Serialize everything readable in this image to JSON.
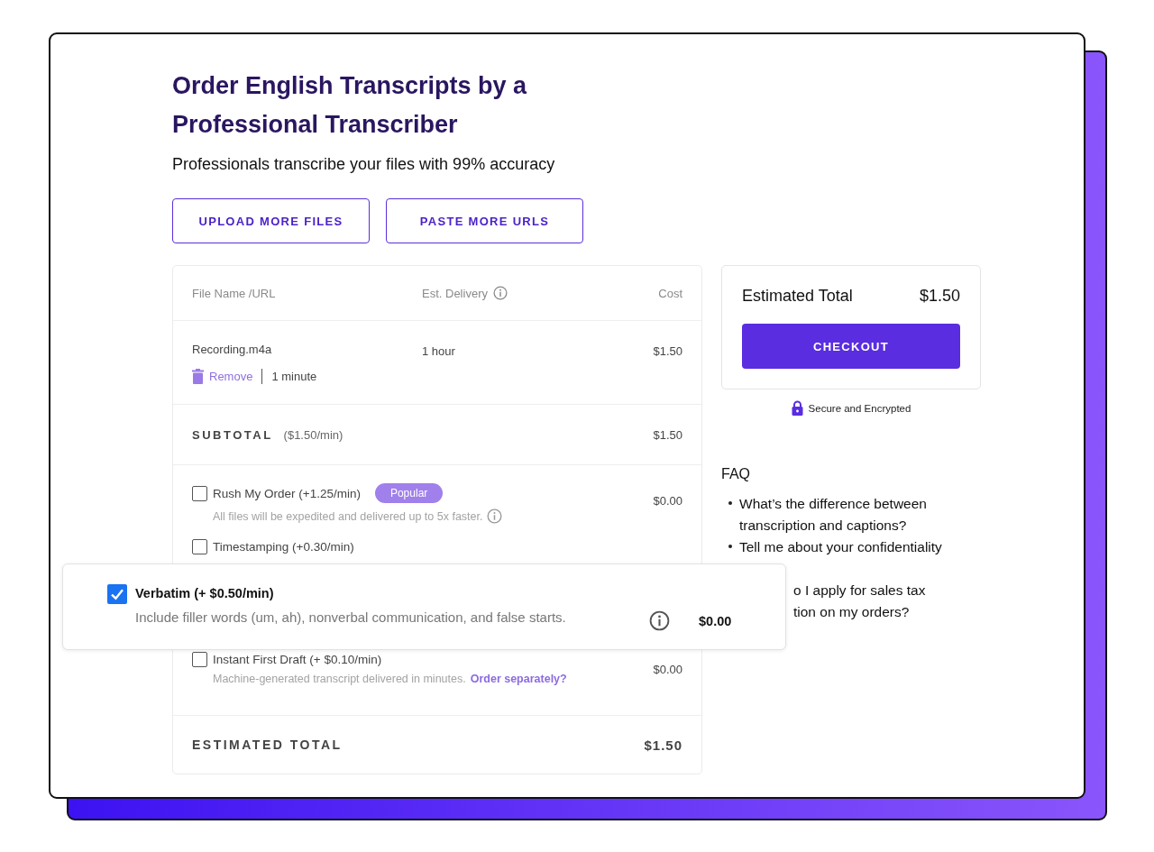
{
  "title": "Order English Transcripts by a Professional Transcriber",
  "subtitle": "Professionals transcribe your files with 99% accuracy",
  "buttons": [
    "UPLOAD MORE FILES",
    "PASTE MORE URLS"
  ],
  "table": {
    "columns": [
      "File Name /URL",
      "Est. Delivery",
      "Cost"
    ],
    "files": [
      {
        "name": "Recording.m4a",
        "delivery": "1 hour",
        "cost": "$1.50",
        "remove": "Remove",
        "duration": "1 minute"
      }
    ],
    "subtotal": {
      "label": "SUBTOTAL",
      "rate": "($1.50/min)",
      "cost": "$1.50"
    },
    "options": [
      {
        "label": "Rush My Order (+1.25/min)",
        "checked": false,
        "badge": "Popular",
        "description": "All files will be expedited and delivered up to 5x faster.",
        "info": true,
        "cost": "$0.00"
      },
      {
        "label": "Timestamping (+0.30/min)",
        "checked": false
      },
      {
        "label": "Instant First Draft (+ $0.10/min)",
        "checked": false,
        "description": "Machine-generated transcript delivered in minutes.",
        "link": "Order separately?",
        "cost": "$0.00"
      }
    ],
    "total": {
      "label": "ESTIMATED TOTAL",
      "cost": "$1.50"
    }
  },
  "summary": {
    "label": "Estimated Total",
    "amount": "$1.50",
    "button": "CHECKOUT",
    "secure": "Secure and Encrypted"
  },
  "faq": {
    "title": "FAQ",
    "items": [
      {
        "lines": [
          "What’s the difference between",
          "transcription and captions?"
        ],
        "bullet": true
      },
      {
        "lines": [
          "Tell me about your confidentiality"
        ],
        "bullet": true
      },
      {
        "lines": [
          "o I apply for sales tax",
          "tion on my orders?"
        ],
        "bullet": false
      }
    ]
  },
  "popup": {
    "label": "Verbatim (+ $0.50/min)",
    "checked": true,
    "description": "Include filler words (um, ah), nonverbal communication, and false starts.",
    "info": true,
    "cost": "$0.00"
  }
}
